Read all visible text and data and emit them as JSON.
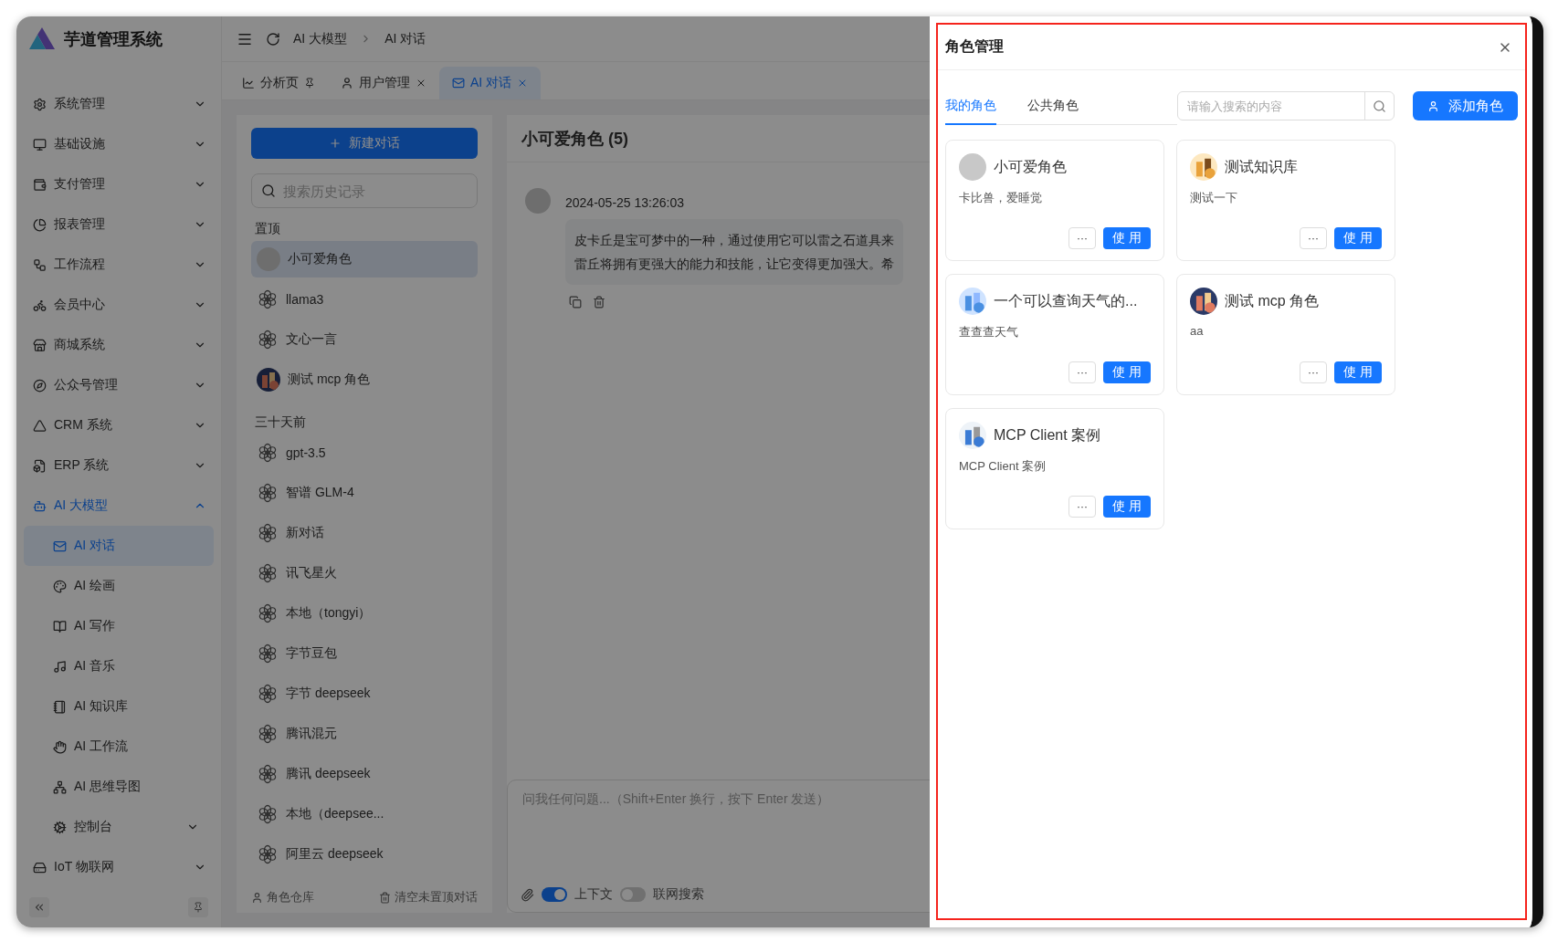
{
  "app": {
    "title": "芋道管理系统"
  },
  "breadcrumb": [
    "AI 大模型",
    "AI 对话"
  ],
  "sidebar": {
    "items": [
      {
        "label": "系统管理",
        "expanded": false
      },
      {
        "label": "基础设施",
        "expanded": false
      },
      {
        "label": "支付管理",
        "expanded": false
      },
      {
        "label": "报表管理",
        "expanded": false
      },
      {
        "label": "工作流程",
        "expanded": false
      },
      {
        "label": "会员中心",
        "expanded": false
      },
      {
        "label": "商城系统",
        "expanded": false
      },
      {
        "label": "公众号管理",
        "expanded": false
      },
      {
        "label": "CRM 系统",
        "expanded": false
      },
      {
        "label": "ERP 系统",
        "expanded": false
      },
      {
        "label": "AI 大模型",
        "expanded": true,
        "children": [
          {
            "label": "AI 对话",
            "selected": true
          },
          {
            "label": "AI 绘画",
            "selected": false
          },
          {
            "label": "AI 写作",
            "selected": false
          },
          {
            "label": "AI 音乐",
            "selected": false
          },
          {
            "label": "AI 知识库",
            "selected": false
          },
          {
            "label": "AI 工作流",
            "selected": false
          },
          {
            "label": "AI 思维导图",
            "selected": false
          },
          {
            "label": "控制台",
            "selected": false,
            "expanded": false
          }
        ]
      },
      {
        "label": "IoT 物联网",
        "expanded": false
      }
    ]
  },
  "tabs": [
    {
      "label": "分析页",
      "selected": false,
      "kind": "pinned"
    },
    {
      "label": "用户管理",
      "selected": false,
      "kind": "closable"
    },
    {
      "label": "AI 对话",
      "selected": true,
      "kind": "closable"
    }
  ],
  "chat_list": {
    "new_button": "新建对话",
    "search": {
      "placeholder": "搜索历史记录"
    },
    "groups": [
      {
        "title": "置顶",
        "items": [
          {
            "label": "小可爱角色",
            "selected": true,
            "kind": "blank"
          },
          {
            "label": "llama3",
            "selected": false,
            "kind": "model"
          },
          {
            "label": "文心一言",
            "selected": false,
            "kind": "model"
          },
          {
            "label": "测试 mcp 角色",
            "selected": false,
            "kind": "picture"
          }
        ]
      },
      {
        "title": "三十天前",
        "items": [
          {
            "label": "gpt-3.5",
            "selected": false,
            "kind": "model"
          },
          {
            "label": "智谱 GLM-4",
            "selected": false,
            "kind": "model"
          },
          {
            "label": "新对话",
            "selected": false,
            "kind": "model"
          },
          {
            "label": "讯飞星火",
            "selected": false,
            "kind": "model"
          },
          {
            "label": "本地（tongyi）",
            "selected": false,
            "kind": "model"
          },
          {
            "label": "字节豆包",
            "selected": false,
            "kind": "model"
          },
          {
            "label": "字节 deepseek",
            "selected": false,
            "kind": "model"
          },
          {
            "label": "腾讯混元",
            "selected": false,
            "kind": "model"
          },
          {
            "label": "腾讯 deepseek",
            "selected": false,
            "kind": "model"
          },
          {
            "label": "本地（deepsee...",
            "selected": false,
            "kind": "model"
          },
          {
            "label": "阿里云 deepseek",
            "selected": false,
            "kind": "model"
          }
        ]
      }
    ],
    "footer": [
      "角色仓库",
      "清空未置顶对话"
    ]
  },
  "chat": {
    "title": "小可爱角色 (5)",
    "message": {
      "time": "2024-05-25 13:26:03",
      "lines": [
        "皮卡丘是宝可梦中的一种，通过使用它可以雷之石道具来",
        "雷丘将拥有更强大的能力和技能，让它变得更加强大。希"
      ]
    },
    "input": {
      "placeholder": "问我任何问题...（Shift+Enter 换行，按下 Enter 发送）"
    },
    "toggles": [
      {
        "label": "上下文",
        "on": true
      },
      {
        "label": "联网搜索",
        "on": false
      }
    ]
  },
  "drawer": {
    "title": "角色管理",
    "tabs": [
      {
        "label": "我的角色",
        "selected": true
      },
      {
        "label": "公共角色",
        "selected": false
      }
    ],
    "search": {
      "placeholder": "请输入搜索的内容"
    },
    "add_button": "添加角色",
    "roles": [
      {
        "name": "小可爱角色",
        "description": "卡比兽，爱睡觉",
        "kind": "blank",
        "more_label": "···",
        "use_label": "使 用"
      },
      {
        "name": "测试知识库",
        "description": "测试一下",
        "kind": "picture",
        "more_label": "···",
        "use_label": "使 用"
      },
      {
        "name": "一个可以查询天气的...",
        "description": "查查查天气",
        "kind": "picture",
        "more_label": "···",
        "use_label": "使 用"
      },
      {
        "name": "测试 mcp 角色",
        "description": "aa",
        "kind": "picture",
        "more_label": "···",
        "use_label": "使 用"
      },
      {
        "name": "MCP Client 案例",
        "description": "MCP Client 案例",
        "kind": "picture",
        "more_label": "···",
        "use_label": "使 用"
      }
    ]
  }
}
